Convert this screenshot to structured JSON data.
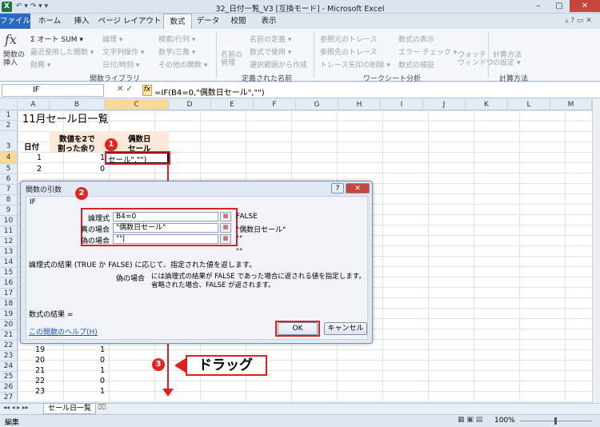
{
  "window": {
    "title": "32_日付一覧_V3  [互換モード] - Microsoft Excel",
    "min": "–",
    "max": "□",
    "close": "✕"
  },
  "qat": {
    "icons": "↶ ▾  ↷ ▾  ▾"
  },
  "tabs": [
    "ファイル",
    "ホーム",
    "挿入",
    "ページ レイアウト",
    "数式",
    "データ",
    "校閲",
    "表示"
  ],
  "ribbon": {
    "insert_function": "関数の\n挿入",
    "autosum": "Σ オート SUM ▾",
    "recent": "最近使用した関数 ▾",
    "financial": "財務 ▾",
    "logical": "論理 ▾",
    "text": "文字列操作 ▾",
    "datetime": "日付/時刻 ▾",
    "lookup": "検索/行列 ▾",
    "math": "数学/三角 ▾",
    "other": "その他の関数 ▾",
    "group_library": "関数ライブラリ",
    "name_manager": "名前の\n管理",
    "define_name": "名前の定義 ▾",
    "use_in_formula": "数式で使用 ▾",
    "create_from_sel": "選択範囲から作成",
    "group_names": "定義された名前",
    "trace_precedents": "参照元のトレース",
    "trace_dependents": "参照先のトレース",
    "remove_arrows": "トレース矢印の削除 ▾",
    "show_formulas": "数式の表示",
    "error_check": "エラー チェック ▾",
    "evaluate": "数式の検証",
    "group_audit": "ワークシート分析",
    "watch": "ウォッチ\nウィンドウ",
    "calc_options": "計算方法\nの設定 ▾",
    "group_calc": "計算方法"
  },
  "formula_bar": {
    "name_box": "IF",
    "formula": "=IF(B4=0,\"偶数日セール\",\"\")"
  },
  "columns": [
    "A",
    "B",
    "C",
    "D",
    "E",
    "F",
    "G",
    "H",
    "I",
    "J",
    "K",
    "L",
    "M"
  ],
  "rows": [
    "1",
    "2",
    "3",
    "4",
    "5",
    "6",
    "7",
    "8",
    "9",
    "10",
    "11",
    "12",
    "13",
    "14",
    "15",
    "16",
    "17",
    "18",
    "19",
    "20",
    "21",
    "22",
    "23",
    "24",
    "25",
    "26",
    "27"
  ],
  "sheet": {
    "title": "11月セール日一覧",
    "h_date": "日付",
    "h_rem1": "数値を2で",
    "h_rem2": "割った余り",
    "h_sale1": "偶数日",
    "h_sale2": "セール",
    "active_text": "セール\",\"\")",
    "r4a": "1",
    "r4b": "1",
    "r5a": "2",
    "r5b": "0",
    "r22a": "19",
    "r22b": "1",
    "r23a": "20",
    "r23b": "0",
    "r24a": "21",
    "r24b": "1",
    "r25a": "22",
    "r25b": "0",
    "r26a": "23",
    "r26b": "1"
  },
  "dialog": {
    "title": "関数の引数",
    "help": "?",
    "close": "✕",
    "func": "IF",
    "l1": "論理式",
    "v1": "B4=0",
    "r1": "FALSE",
    "l2": "真の場合",
    "v2": "\"偶数日セール\"",
    "r2": "\"偶数日セール\"",
    "l3": "偽の場合",
    "v3": "\"\"|",
    "r3": "\"\"",
    "r4": "\"\"",
    "desc": "論理式の結果 (TRUE か FALSE) に応じて、指定された値を返します。",
    "arg_name": "偽の場合",
    "arg_desc": "には論理式の結果が FALSE であった場合に返される値を指定します。省略された場合、FALSE が返されます。",
    "result": "数式の結果 =",
    "help_link": "この関数のヘルプ(H)",
    "ok": "OK",
    "cancel": "キャンセル"
  },
  "annotations": {
    "b1": "1",
    "b2": "2",
    "b3": "3",
    "drag": "ドラッグ"
  },
  "sheet_tab": "セール日一覧",
  "status": {
    "mode": "編集",
    "zoom": "100%"
  },
  "colors": {
    "accent_red": "#e0261f",
    "file_tab": "#2a6bc1"
  }
}
